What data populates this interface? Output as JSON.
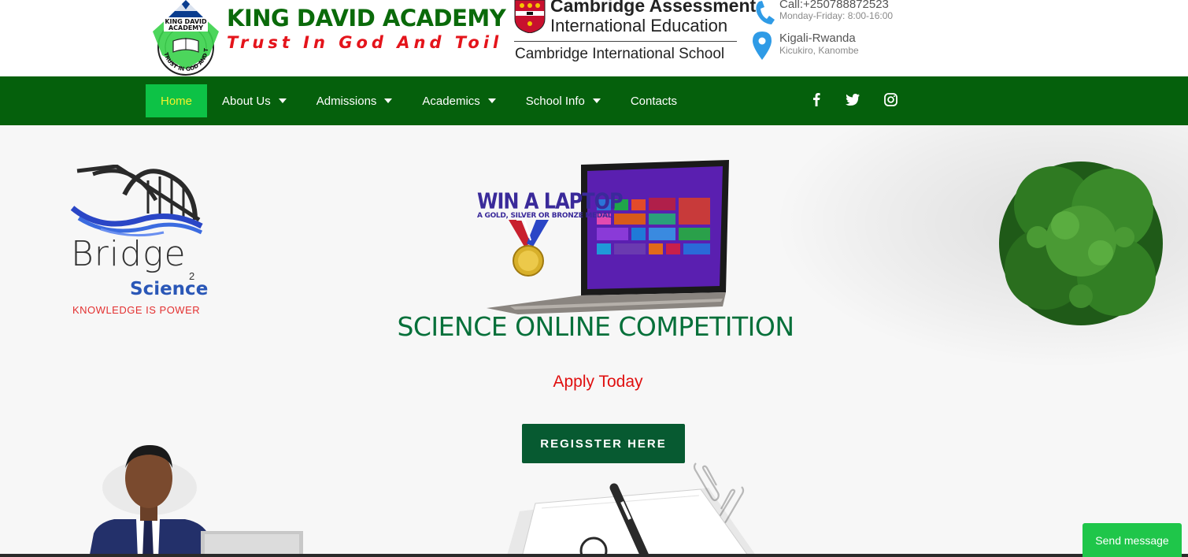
{
  "header": {
    "brand_name": "KING DAVID ACADEMY",
    "brand_motto": "Trust In God And Toil",
    "logo_badge_text_top": "KING DAVID",
    "logo_badge_text_mid": "ACADEMY",
    "logo_badge_ring_text": "TRUST IN GOD AND TOIL",
    "cambridge_line1": "Cambridge Assessment",
    "cambridge_line2": "International Education",
    "cambridge_line3": "Cambridge International School",
    "contact_phone": "Call:+250788872523",
    "contact_hours": "Monday-Friday: 8:00-16:00",
    "contact_city": "Kigali-Rwanda",
    "contact_area": "Kicukiro, Kanombe"
  },
  "nav": {
    "items": [
      {
        "label": "Home",
        "active": true,
        "dropdown": false
      },
      {
        "label": "About Us",
        "active": false,
        "dropdown": true
      },
      {
        "label": "Admissions",
        "active": false,
        "dropdown": true
      },
      {
        "label": "Academics",
        "active": false,
        "dropdown": true
      },
      {
        "label": "School Info",
        "active": false,
        "dropdown": true
      },
      {
        "label": "Contacts",
        "active": false,
        "dropdown": false
      }
    ],
    "social": [
      "facebook-icon",
      "twitter-icon",
      "instagram-icon"
    ]
  },
  "hero": {
    "b2s_word": "Bridge",
    "b2s_two": "2",
    "b2s_science": "Science",
    "b2s_tag": "KNOWLEDGE IS POWER",
    "win_title": "WIN A LAPTOP",
    "win_sub": "A GOLD, SILVER OR BRONZE MEDAL",
    "title": "SCIENCE ONLINE COMPETITION",
    "apply": "Apply Today",
    "button_label": "REGISSTER HERE"
  },
  "chat": {
    "send_label": "Send message"
  },
  "colors": {
    "nav_green": "#05600c",
    "active_green": "#0dc246",
    "brand_green": "#0a6a0a",
    "motto_red": "#e4141b",
    "title_green": "#06703a",
    "button_green": "#075a31",
    "chat_green": "#1fc64a"
  }
}
